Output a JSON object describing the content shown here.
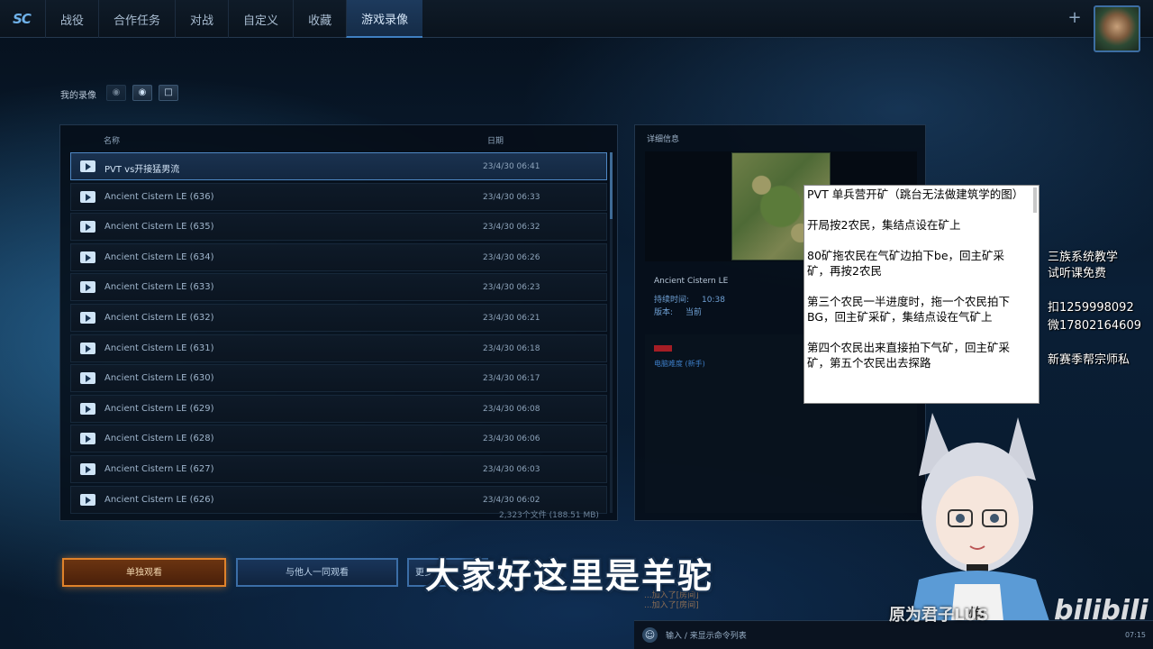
{
  "nav": {
    "logo": "SC",
    "tabs": [
      "战役",
      "合作任务",
      "对战",
      "自定义",
      "收藏",
      "游戏录像"
    ],
    "active_tab": "游戏录像",
    "plus": "+"
  },
  "toolbar": {
    "label": "我的录像",
    "icons": [
      "camera-icon",
      "camera-add-icon",
      "folder-icon"
    ]
  },
  "replay_list": {
    "col_name": "名称",
    "col_date": "日期",
    "rows": [
      {
        "name": "PVT vs开接猛男流",
        "date": "23/4/30 06:41",
        "selected": true
      },
      {
        "name": "Ancient Cistern LE (636)",
        "date": "23/4/30 06:33"
      },
      {
        "name": "Ancient Cistern LE (635)",
        "date": "23/4/30 06:32"
      },
      {
        "name": "Ancient Cistern LE (634)",
        "date": "23/4/30 06:26"
      },
      {
        "name": "Ancient Cistern LE (633)",
        "date": "23/4/30 06:23"
      },
      {
        "name": "Ancient Cistern LE (632)",
        "date": "23/4/30 06:21"
      },
      {
        "name": "Ancient Cistern LE (631)",
        "date": "23/4/30 06:18"
      },
      {
        "name": "Ancient Cistern LE (630)",
        "date": "23/4/30 06:17"
      },
      {
        "name": "Ancient Cistern LE (629)",
        "date": "23/4/30 06:08"
      },
      {
        "name": "Ancient Cistern LE (628)",
        "date": "23/4/30 06:06"
      },
      {
        "name": "Ancient Cistern LE (627)",
        "date": "23/4/30 06:03"
      },
      {
        "name": "Ancient Cistern LE (626)",
        "date": "23/4/30 06:02"
      }
    ],
    "file_count": "2,323个文件 (188.51 MB)"
  },
  "details": {
    "title": "详细信息",
    "map_name": "Ancient Cistern LE",
    "duration_label": "持续时间:",
    "duration_value": "10:38",
    "version_label": "版本:",
    "version_value": "当前",
    "player_name": "电脑难度 (新手)",
    "player_color": "#a51d25"
  },
  "notes": {
    "paragraphs": [
      "PVT 单兵营开矿（跳台无法做建筑学的图）",
      "开局按2农民，集结点设在矿上",
      "80矿拖农民在气矿边拍下be，回主矿采矿，再按2农民",
      "第三个农民一半进度时，拖一个农民拍下BG，回主矿采矿，集结点设在气矿上",
      "第四个农民出来直接拍下气矿，回主矿采矿，第五个农民出去探路"
    ]
  },
  "promo": {
    "line1": "三族系统教学",
    "line2": "试听课免费",
    "line3": "扣1259998092",
    "line4": "微17802164609",
    "line5": "新赛季帮宗师私"
  },
  "buttons": {
    "watch_alone": "单独观看",
    "watch_together": "与他人一同观看",
    "more": "更多"
  },
  "subtitle": "大家好这里是羊驼",
  "chat_messages": [
    "...加入了[房间]",
    "...加入了[房间]"
  ],
  "chat": {
    "placeholder": "输入 / 来显示命令列表",
    "clock": "07:15"
  },
  "watermark": {
    "author": "原为君子LUS",
    "logo": "bilibili"
  }
}
